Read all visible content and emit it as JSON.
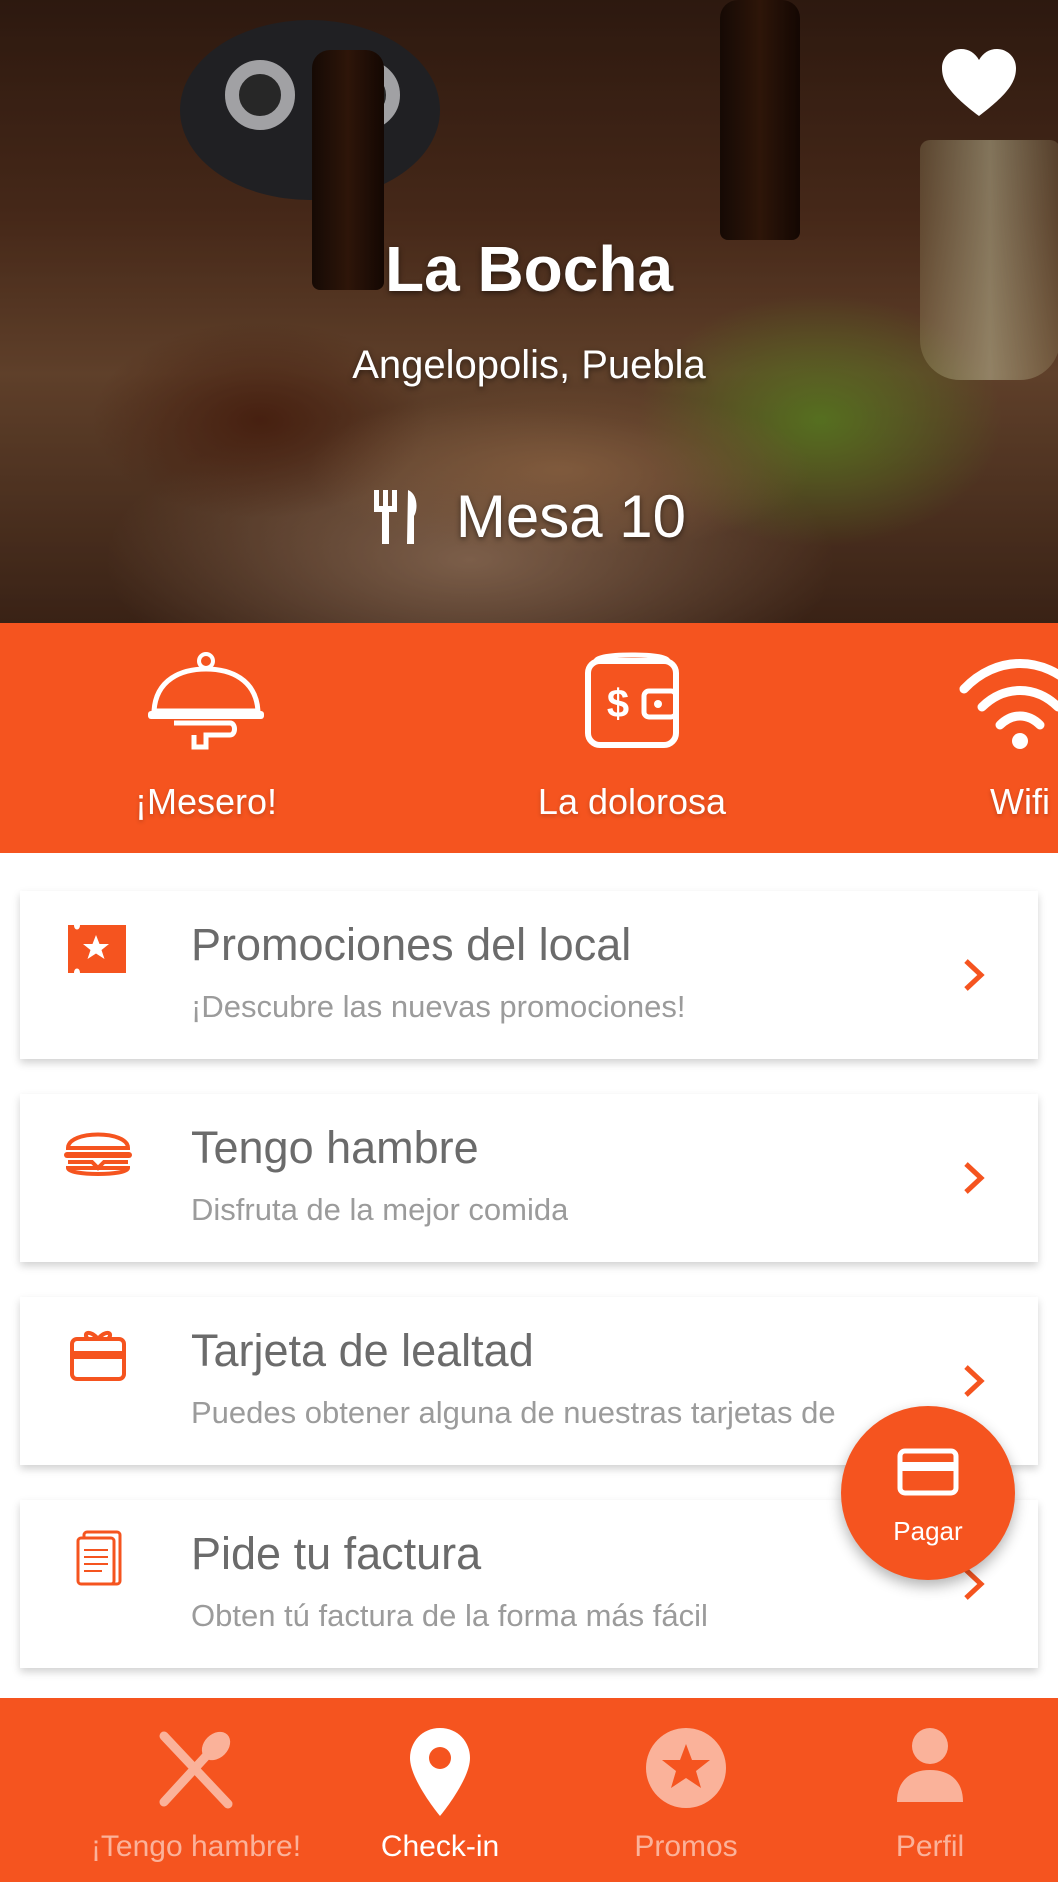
{
  "colors": {
    "accent": "#f5541f",
    "card_title": "#6b6b6b",
    "card_subtitle": "#9b9b9b"
  },
  "header": {
    "venue_name": "La Bocha",
    "location": "Angelopolis, Puebla",
    "table": "Mesa 10",
    "favorite_icon": "heart-icon",
    "table_icon": "fork-knife-icon"
  },
  "quick_actions": [
    {
      "label": "¡Mesero!",
      "icon": "serving-bell-icon"
    },
    {
      "label": "La dolorosa",
      "icon": "wallet-icon"
    },
    {
      "label": "Wifi",
      "icon": "wifi-icon"
    }
  ],
  "menu_cards": [
    {
      "title": "Promociones del local",
      "subtitle": "¡Descubre las nuevas promociones!",
      "icon": "ticket-star-icon"
    },
    {
      "title": "Tengo hambre",
      "subtitle": "Disfruta de la mejor comida",
      "icon": "burger-icon"
    },
    {
      "title": "Tarjeta de lealtad",
      "subtitle": "Puedes obtener alguna de nuestras tarjetas de",
      "icon": "gift-card-icon"
    },
    {
      "title": "Pide tu factura",
      "subtitle": "Obten tú factura de la forma más fácil",
      "icon": "invoice-icon"
    }
  ],
  "pay_button": {
    "label": "Pagar",
    "icon": "credit-card-icon"
  },
  "bottom_nav": [
    {
      "label": "¡Tengo hambre!",
      "icon": "fork-spoon-icon",
      "active": false
    },
    {
      "label": "Check-in",
      "icon": "location-pin-icon",
      "active": true
    },
    {
      "label": "Promos",
      "icon": "star-circle-icon",
      "active": false
    },
    {
      "label": "Perfil",
      "icon": "user-icon",
      "active": false
    }
  ]
}
